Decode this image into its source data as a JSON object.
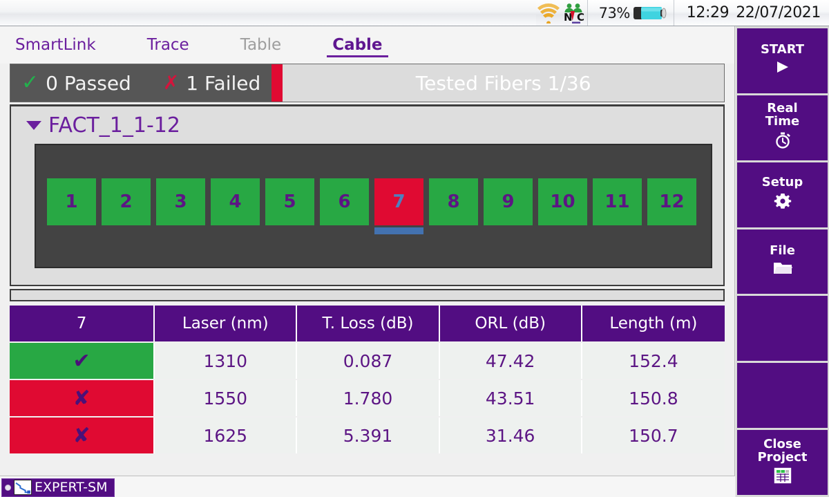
{
  "statusbar": {
    "wifi_icon": "wifi-signal-icon",
    "vnc_icon": "vnc-icon",
    "battery_percent": "73%",
    "battery_icon": "battery-icon",
    "time": "12:29",
    "date": "22/07/2021"
  },
  "tabs": [
    {
      "label": "SmartLink",
      "state": "enabled"
    },
    {
      "label": "Trace",
      "state": "enabled"
    },
    {
      "label": "Table",
      "state": "disabled"
    },
    {
      "label": "Cable",
      "state": "active"
    }
  ],
  "summary": {
    "passed_label": "0 Passed",
    "failed_label": "1 Failed",
    "tested_label": "Tested Fibers 1/36",
    "progress_percent": 3,
    "pass_color": "#22b14c",
    "fail_color": "#d4143c",
    "bar_color": "#e00a32"
  },
  "cable": {
    "group_name": "FACT_1_1-12",
    "expanded": true,
    "fibers": [
      {
        "number": "1",
        "status": "pass",
        "selected": false
      },
      {
        "number": "2",
        "status": "pass",
        "selected": false
      },
      {
        "number": "3",
        "status": "pass",
        "selected": false
      },
      {
        "number": "4",
        "status": "pass",
        "selected": false
      },
      {
        "number": "5",
        "status": "pass",
        "selected": false
      },
      {
        "number": "6",
        "status": "pass",
        "selected": false
      },
      {
        "number": "7",
        "status": "fail",
        "selected": true
      },
      {
        "number": "8",
        "status": "pass",
        "selected": false
      },
      {
        "number": "9",
        "status": "pass",
        "selected": false
      },
      {
        "number": "10",
        "status": "pass",
        "selected": false
      },
      {
        "number": "11",
        "status": "pass",
        "selected": false
      },
      {
        "number": "12",
        "status": "pass",
        "selected": false
      }
    ]
  },
  "table": {
    "headers": [
      "7",
      "Laser (nm)",
      "T. Loss (dB)",
      "ORL (dB)",
      "Length (m)"
    ],
    "rows": [
      {
        "status": "pass",
        "mark": "✔",
        "laser": "1310",
        "loss": "0.087",
        "orl": "47.42",
        "length": "152.4"
      },
      {
        "status": "fail",
        "mark": "✘",
        "laser": "1550",
        "loss": "1.780",
        "orl": "43.51",
        "length": "150.8"
      },
      {
        "status": "fail",
        "mark": "✘",
        "laser": "1625",
        "loss": "5.391",
        "orl": "31.46",
        "length": "150.7"
      }
    ]
  },
  "sidebar": {
    "buttons": [
      {
        "label": "START",
        "icon": "play-icon"
      },
      {
        "label": "Real\nTime",
        "icon": "stopwatch-icon"
      },
      {
        "label": "Setup",
        "icon": "gear-icon"
      },
      {
        "label": "File",
        "icon": "folder-icon"
      },
      {
        "label": "",
        "icon": ""
      },
      {
        "label": "",
        "icon": ""
      },
      {
        "label": "Close\nProject",
        "icon": "grid-table-icon"
      }
    ]
  },
  "taskbar": {
    "app_label": "EXPERT-SM",
    "app_icon": "otdr-trace-icon"
  },
  "colors": {
    "purple": "#520d82",
    "purple_text": "#6b1f9e",
    "green": "#28a844",
    "red": "#e00a32",
    "blue_select": "#4372b0",
    "dark_panel": "#434343"
  }
}
